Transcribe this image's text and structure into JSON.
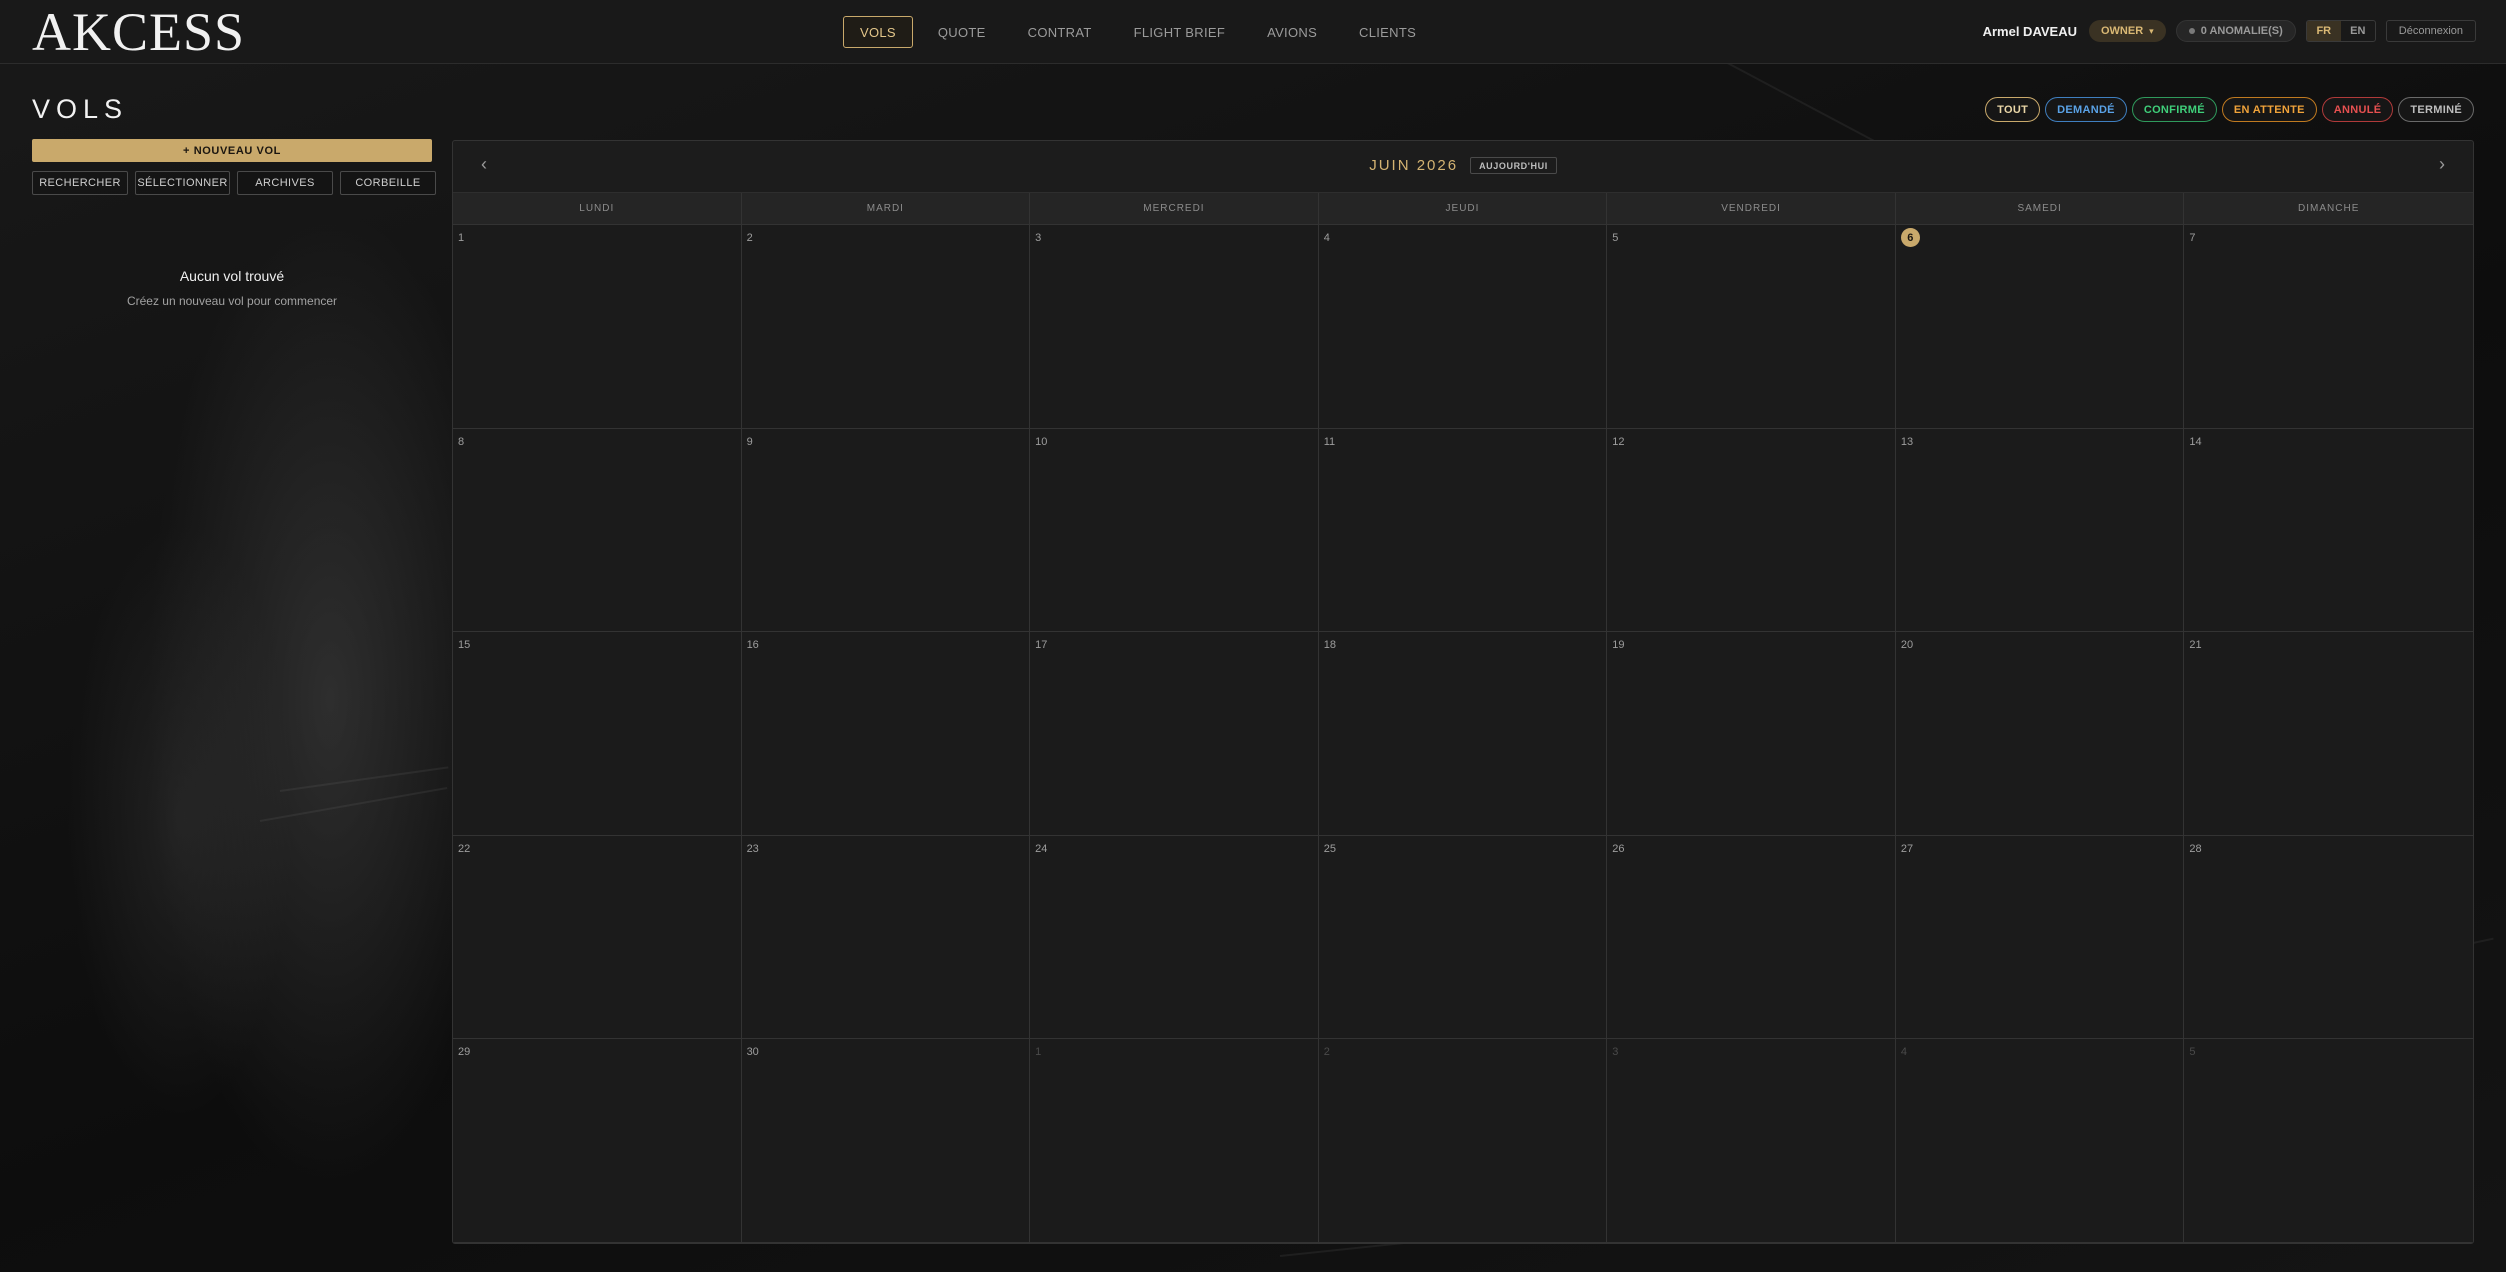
{
  "app": {
    "logo": "AKCESS",
    "nav": [
      {
        "label": "VOLS",
        "active": true
      },
      {
        "label": "QUOTE",
        "active": false
      },
      {
        "label": "CONTRAT",
        "active": false
      },
      {
        "label": "FLIGHT BRIEF",
        "active": false
      },
      {
        "label": "AVIONS",
        "active": false
      },
      {
        "label": "CLIENTS",
        "active": false
      }
    ],
    "user": {
      "name": "Armel DAVEAU",
      "role": "OWNER",
      "role_caret": "▾",
      "anomalies": "0 ANOMALIE(S)",
      "lang_fr": "FR",
      "lang_en": "EN",
      "active_lang": "FR",
      "logout": "Déconnexion"
    }
  },
  "sidebar": {
    "title": "VOLS",
    "new_button": "+ NOUVEAU VOL",
    "tools": [
      "RECHERCHER",
      "SÉLECTIONNER",
      "ARCHIVES",
      "CORBEILLE"
    ],
    "empty_title": "Aucun vol trouvé",
    "empty_subtitle": "Créez un nouveau vol pour commencer"
  },
  "filters": [
    {
      "label": "TOUT",
      "color": "#e9d6a7",
      "border": "#c9a96b"
    },
    {
      "label": "DEMANDÉ",
      "color": "#5aa2e6",
      "border": "#3f7fc0"
    },
    {
      "label": "CONFIRMÉ",
      "color": "#3fcf7a",
      "border": "#2f9a5c"
    },
    {
      "label": "EN ATTENTE",
      "color": "#f0a33a",
      "border": "#c07a20"
    },
    {
      "label": "ANNULÉ",
      "color": "#e65050",
      "border": "#b03a3a"
    },
    {
      "label": "TERMINÉ",
      "color": "#bdbdbd",
      "border": "#6a6a6a"
    }
  ],
  "calendar": {
    "prev": "‹",
    "next": "›",
    "month": "JUIN 2026",
    "today_button": "AUJOURD'HUI",
    "weekdays": [
      "LUNDI",
      "MARDI",
      "MERCREDI",
      "JEUDI",
      "VENDREDI",
      "SAMEDI",
      "DIMANCHE"
    ],
    "today": 6,
    "days": [
      {
        "n": "1",
        "cur": true
      },
      {
        "n": "2",
        "cur": true
      },
      {
        "n": "3",
        "cur": true
      },
      {
        "n": "4",
        "cur": true
      },
      {
        "n": "5",
        "cur": true
      },
      {
        "n": "6",
        "cur": true
      },
      {
        "n": "7",
        "cur": true
      },
      {
        "n": "8",
        "cur": true
      },
      {
        "n": "9",
        "cur": true
      },
      {
        "n": "10",
        "cur": true
      },
      {
        "n": "11",
        "cur": true
      },
      {
        "n": "12",
        "cur": true
      },
      {
        "n": "13",
        "cur": true
      },
      {
        "n": "14",
        "cur": true
      },
      {
        "n": "15",
        "cur": true
      },
      {
        "n": "16",
        "cur": true
      },
      {
        "n": "17",
        "cur": true
      },
      {
        "n": "18",
        "cur": true
      },
      {
        "n": "19",
        "cur": true
      },
      {
        "n": "20",
        "cur": true
      },
      {
        "n": "21",
        "cur": true
      },
      {
        "n": "22",
        "cur": true
      },
      {
        "n": "23",
        "cur": true
      },
      {
        "n": "24",
        "cur": true
      },
      {
        "n": "25",
        "cur": true
      },
      {
        "n": "26",
        "cur": true
      },
      {
        "n": "27",
        "cur": true
      },
      {
        "n": "28",
        "cur": true
      },
      {
        "n": "29",
        "cur": true
      },
      {
        "n": "30",
        "cur": true
      },
      {
        "n": "1",
        "cur": false
      },
      {
        "n": "2",
        "cur": false
      },
      {
        "n": "3",
        "cur": false
      },
      {
        "n": "4",
        "cur": false
      },
      {
        "n": "5",
        "cur": false
      }
    ]
  },
  "colors": {
    "accent": "#c9a96b",
    "background": "#111111",
    "panel": "#1c1c1c"
  }
}
